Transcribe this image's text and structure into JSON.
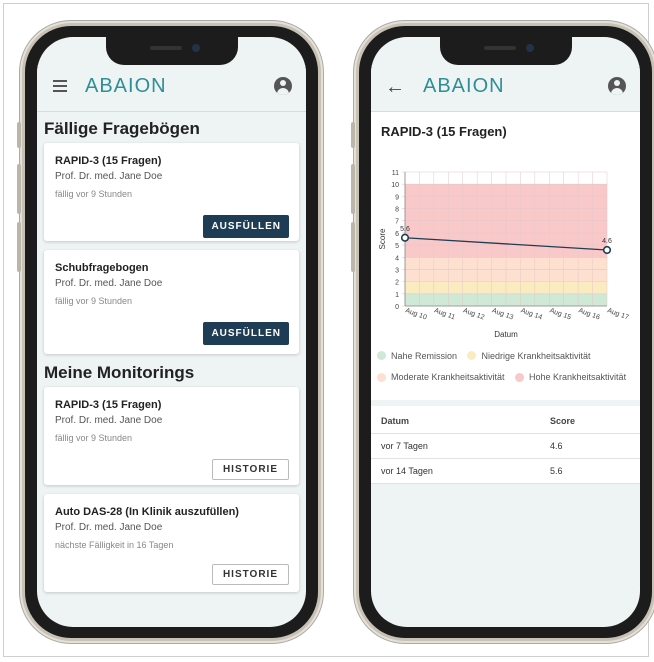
{
  "left_phone": {
    "app_logo": "ABAION",
    "sections": [
      {
        "title": "Fällige Fragebögen",
        "cards": [
          {
            "title": "RAPID-3 (15 Fragen)",
            "doctor": "Prof. Dr. med. Jane Doe",
            "due": "fällig vor 9 Stunden",
            "button": "AUSFÜLLEN"
          },
          {
            "title": "Schubfragebogen",
            "doctor": "Prof. Dr. med. Jane Doe",
            "due": "fällig vor 9 Stunden",
            "button": "AUSFÜLLEN"
          }
        ]
      },
      {
        "title": "Meine Monitorings",
        "cards": [
          {
            "title": "RAPID-3 (15 Fragen)",
            "doctor": "Prof. Dr. med. Jane Doe",
            "due": "fällig vor 9 Stunden",
            "button": "HISTORIE"
          },
          {
            "title": "Auto DAS-28 (In Klinik auszufüllen)",
            "doctor": "Prof. Dr. med. Jane Doe",
            "due": "nächste Fälligkeit in 16 Tagen",
            "button": "HISTORIE"
          }
        ]
      }
    ]
  },
  "right_phone": {
    "app_logo": "ABAION",
    "title": "RAPID-3 (15 Fragen)",
    "legend": [
      {
        "label": "Nahe Remission",
        "color": "#cfe9d6"
      },
      {
        "label": "Niedrige Krankheitsaktivität",
        "color": "#faecc0"
      },
      {
        "label": "Moderate Krankheitsaktivität",
        "color": "#fde0cf"
      },
      {
        "label": "Hohe Krankheitsaktivität",
        "color": "#f9c9c9"
      }
    ],
    "table": {
      "headers": [
        "Datum",
        "Score"
      ],
      "rows": [
        [
          "vor 7 Tagen",
          "4.6"
        ],
        [
          "vor 14 Tagen",
          "5.6"
        ]
      ]
    }
  },
  "chart_data": {
    "type": "line",
    "xlabel": "Datum",
    "ylabel": "Score",
    "x_ticks": [
      "Aug 10",
      "Aug 11",
      "Aug 12",
      "Aug 13",
      "Aug 14",
      "Aug 15",
      "Aug 16",
      "Aug 17"
    ],
    "ylim": [
      0,
      11
    ],
    "y_ticks": [
      0,
      1,
      2,
      3,
      4,
      5,
      6,
      7,
      8,
      9,
      10,
      11
    ],
    "series": [
      {
        "points": [
          {
            "x": "Aug 10",
            "y": 5.6,
            "label": "5.6"
          },
          {
            "x": "Aug 17",
            "y": 4.6,
            "label": "4.6"
          }
        ]
      }
    ],
    "bands": [
      {
        "from": 0,
        "to": 1,
        "color": "#cfe9d6"
      },
      {
        "from": 1,
        "to": 2,
        "color": "#faecc0"
      },
      {
        "from": 2,
        "to": 4,
        "color": "#fde0cf"
      },
      {
        "from": 4,
        "to": 10,
        "color": "#f9c9c9"
      }
    ],
    "grid": true,
    "colors": {
      "line": "#1e3d54",
      "grid": "#e6c7c7"
    }
  }
}
